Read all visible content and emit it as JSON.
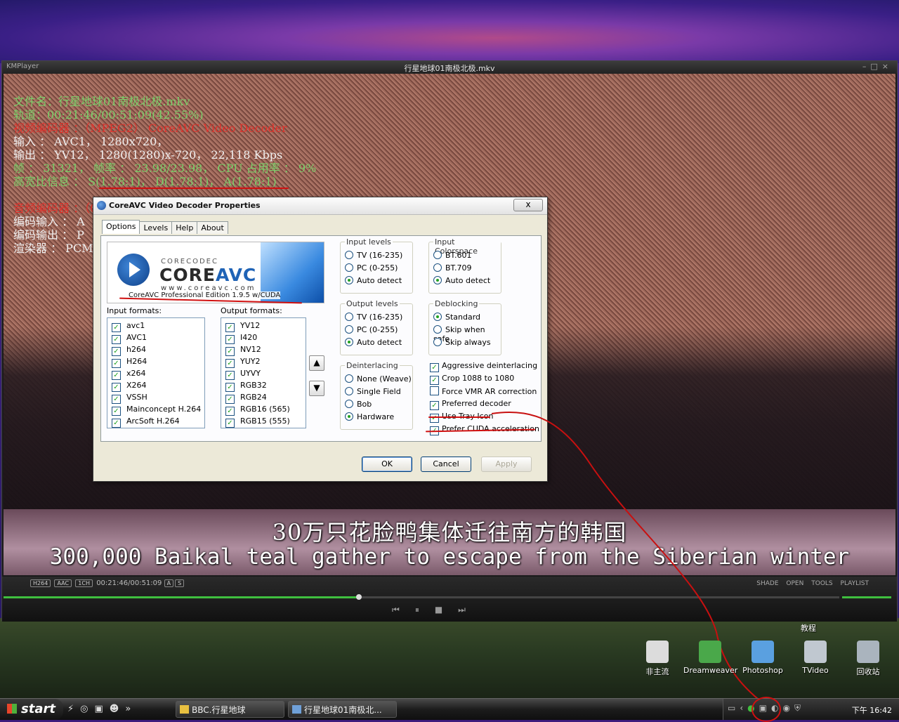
{
  "player": {
    "app_name": "KMPlayer",
    "title": "行星地球01南极北极.mkv",
    "osd": [
      {
        "text": "文件名：行星地球01南极北极.mkv",
        "color": "green"
      },
      {
        "text": "轨道：00:21:46/00:51:09(42.55%)",
        "color": "green"
      },
      {
        "text": "视频编码器 ：（MPEG2） CoreAVC Video Decoder",
        "color": "red"
      },
      {
        "text": "输入 ： AVC1， 1280x720，",
        "color": "white"
      },
      {
        "text": "输出 ： YV12， 1280(1280)x-720， 22,118 Kbps",
        "color": "white"
      },
      {
        "text": "帧 ： 31321， 帧率 ： 23.98/23.98， CPU 占用率 ： 9%",
        "color": "green"
      },
      {
        "text": "高宽比信息 ： S(1.78:1)， D(1.78:1)， A(1.78:1)",
        "color": "green"
      },
      {
        "text": "",
        "color": "white"
      },
      {
        "text": "音频编码器 ：（0xFF） CoreAAC Audio Decoder",
        "color": "red"
      },
      {
        "text": "编码输入 ： A",
        "color": "white"
      },
      {
        "text": "编码输出 ： P",
        "color": "white"
      },
      {
        "text": "渲染器 ： PCM",
        "color": "white"
      }
    ],
    "subtitle_cn": "30万只花脸鸭集体迁往南方的韩国",
    "subtitle_en": "300,000 Baikal teal gather to escape from the Siberian winter",
    "badges": [
      "H264",
      "AAC",
      "1CH"
    ],
    "time": "00:21:46/00:51:09",
    "time_badges": [
      "A",
      "S"
    ],
    "right_controls": [
      "SHADE",
      "OPEN",
      "TOOLS",
      "PLAYLIST"
    ],
    "progress_fraction": 0.4255,
    "transport_icons": [
      "prev-icon",
      "pause-icon",
      "stop-icon",
      "next-icon"
    ]
  },
  "dialog": {
    "title": "CoreAVC Video Decoder Properties",
    "close_label": "x",
    "tabs": [
      "Options",
      "Levels",
      "Help",
      "About"
    ],
    "logo": {
      "sub": "CORECODEC",
      "main_prefix": "CORE",
      "main_suffix": "AVC",
      "url": "www.coreavc.com",
      "edition": "CoreAVC Professional Edition 1.9.5 w/CUDA"
    },
    "input_formats_label": "Input formats:",
    "output_formats_label": "Output formats:",
    "input_formats": [
      "avc1",
      "AVC1",
      "h264",
      "H264",
      "x264",
      "X264",
      "VSSH",
      "Mainconcept H.264",
      "ArcSoft H.264"
    ],
    "output_formats": [
      "YV12",
      "I420",
      "NV12",
      "YUY2",
      "UYVY",
      "RGB32",
      "RGB24",
      "RGB16 (565)",
      "RGB15 (555)"
    ],
    "input_levels": {
      "title": "Input levels",
      "options": [
        "TV (16-235)",
        "PC (0-255)",
        "Auto detect"
      ],
      "selected": 2
    },
    "input_colorspace": {
      "title": "Input Colorspace",
      "options": [
        "BT.601",
        "BT.709",
        "Auto detect"
      ],
      "selected": 2
    },
    "output_levels": {
      "title": "Output levels",
      "options": [
        "TV (16-235)",
        "PC (0-255)",
        "Auto detect"
      ],
      "selected": 2
    },
    "deblocking": {
      "title": "Deblocking",
      "options": [
        "Standard",
        "Skip when safe",
        "Skip always"
      ],
      "selected": 0
    },
    "deinterlacing": {
      "title": "Deinterlacing",
      "options": [
        "None (Weave)",
        "Single Field",
        "Bob",
        "Hardware"
      ],
      "selected": 3
    },
    "checkboxes": [
      {
        "label": "Aggressive deinterlacing",
        "checked": true
      },
      {
        "label": "Crop 1088 to 1080",
        "checked": true
      },
      {
        "label": "Force VMR AR correction",
        "checked": false
      },
      {
        "label": "Preferred decoder",
        "checked": true
      },
      {
        "label": "Use Tray Icon",
        "checked": true
      },
      {
        "label": "Prefer CUDA acceleration",
        "checked": true
      }
    ],
    "ok": "OK",
    "cancel": "Cancel",
    "apply": "Apply"
  },
  "desktop": {
    "top_label": "教程",
    "icons": [
      {
        "label": "非主流",
        "color": "#dcdcdc"
      },
      {
        "label": "Dreamweaver",
        "color": "#4aa84a"
      },
      {
        "label": "Photoshop",
        "color": "#5aa0e0"
      },
      {
        "label": "TVideo",
        "color": "#c0c8d0"
      },
      {
        "label": "回收站",
        "color": "#aab4be"
      }
    ]
  },
  "taskbar": {
    "start": "start",
    "quicklaunch": "»",
    "buttons": [
      {
        "label": "BBC.行星地球",
        "icon_color": "#e8c040"
      },
      {
        "label": "行星地球01南极北...",
        "icon_color": "#6fa0d8"
      }
    ],
    "clock": "下午 16:42"
  }
}
